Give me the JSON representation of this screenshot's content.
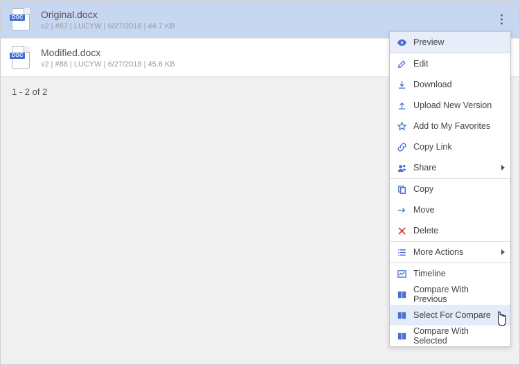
{
  "files": [
    {
      "name": "Original.docx",
      "meta": "v2 | #87 | LUCYW | 6/27/2018 | 44.7 KB",
      "badge": "DOC"
    },
    {
      "name": "Modified.docx",
      "meta": "v2 | #88 | LUCYW | 6/27/2018 | 45.6 KB",
      "badge": "DOC"
    }
  ],
  "pagination": "1 - 2 of 2",
  "menu": {
    "preview": "Preview",
    "edit": "Edit",
    "download": "Download",
    "upload": "Upload New Version",
    "favorites": "Add to My Favorites",
    "copylink": "Copy Link",
    "share": "Share",
    "copy": "Copy",
    "move": "Move",
    "delete": "Delete",
    "more": "More Actions",
    "timeline": "Timeline",
    "compare_prev": "Compare With Previous",
    "select_compare": "Select For Compare",
    "compare_selected": "Compare With Selected"
  }
}
